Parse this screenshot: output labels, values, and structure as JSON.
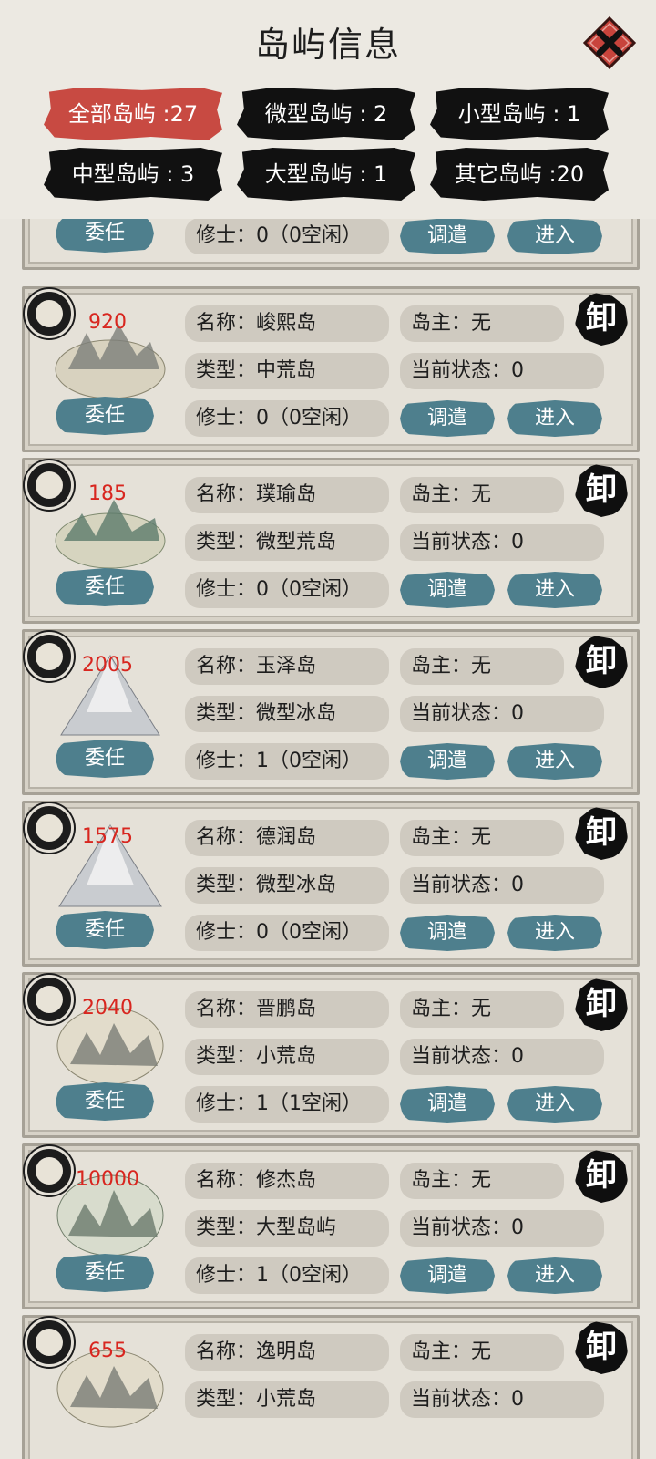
{
  "header": {
    "title": "岛屿信息"
  },
  "filters": [
    {
      "label": "全部岛屿 :27",
      "active": true
    },
    {
      "label": "微型岛屿 : 2",
      "active": false
    },
    {
      "label": "小型岛屿 : 1",
      "active": false
    },
    {
      "label": "中型岛屿 : 3",
      "active": false
    },
    {
      "label": "大型岛屿 : 1",
      "active": false
    },
    {
      "label": "其它岛屿 :20",
      "active": false
    }
  ],
  "labels": {
    "appoint": "委任",
    "dispatch": "调遣",
    "enter": "进入",
    "seal_char": "卸"
  },
  "cards": [
    {
      "number": "",
      "name": "",
      "type": "",
      "owner": "",
      "status": "",
      "cultivators": "修士：0（0空闲）"
    },
    {
      "number": "920",
      "name": "名称：峻熙岛",
      "type": "类型：中荒岛",
      "owner": "岛主：无",
      "status": "当前状态：0",
      "cultivators": "修士：0（0空闲）"
    },
    {
      "number": "185",
      "name": "名称：璞瑜岛",
      "type": "类型：微型荒岛",
      "owner": "岛主：无",
      "status": "当前状态：0",
      "cultivators": "修士：0（0空闲）"
    },
    {
      "number": "2005",
      "name": "名称：玉泽岛",
      "type": "类型：微型冰岛",
      "owner": "岛主：无",
      "status": "当前状态：0",
      "cultivators": "修士：1（0空闲）"
    },
    {
      "number": "1575",
      "name": "名称：德润岛",
      "type": "类型：微型冰岛",
      "owner": "岛主：无",
      "status": "当前状态：0",
      "cultivators": "修士：0（0空闲）"
    },
    {
      "number": "2040",
      "name": "名称：晋鹏岛",
      "type": "类型：小荒岛",
      "owner": "岛主：无",
      "status": "当前状态：0",
      "cultivators": "修士：1（1空闲）"
    },
    {
      "number": "10000",
      "name": "名称：修杰岛",
      "type": "类型：大型岛屿",
      "owner": "岛主：无",
      "status": "当前状态：0",
      "cultivators": "修士：1（0空闲）"
    },
    {
      "number": "655",
      "name": "名称：逸明岛",
      "type": "类型：小荒岛",
      "owner": "岛主：无",
      "status": "当前状态：0",
      "cultivators": ""
    }
  ],
  "colors": {
    "accent_red": "#c84a42",
    "teal_button": "#4e7f8d",
    "number_red": "#d8261f"
  },
  "icons": {
    "close": "close-icon",
    "location": "location-pin-icon",
    "island": "island-illustration",
    "seal": "unload-seal-icon"
  }
}
